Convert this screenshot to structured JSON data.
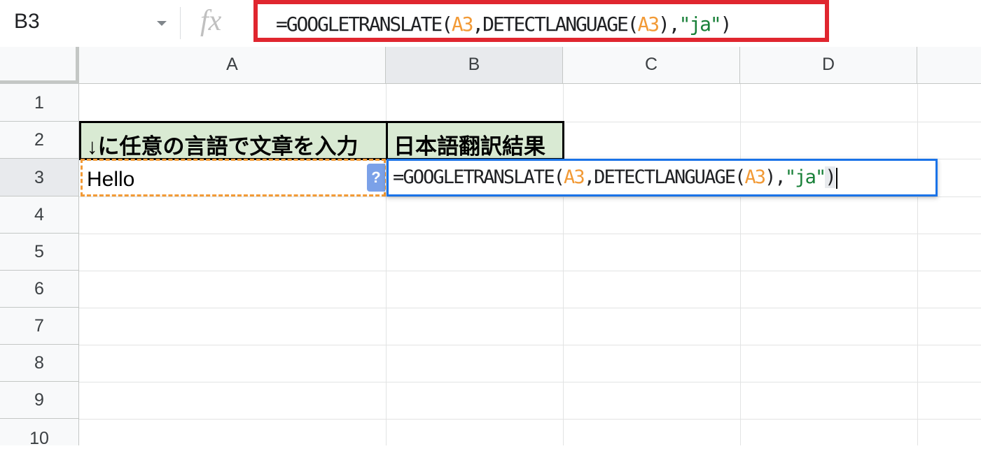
{
  "name_box": {
    "value": "B3"
  },
  "formula_bar": {
    "fx_label": "fx",
    "tokens": [
      {
        "t": "=GOOGLETRANSLATE(",
        "k": "plain"
      },
      {
        "t": "A3",
        "k": "ref"
      },
      {
        "t": ",DETECTLANGUAGE(",
        "k": "plain"
      },
      {
        "t": "A3",
        "k": "ref"
      },
      {
        "t": "),",
        "k": "plain"
      },
      {
        "t": "\"ja\"",
        "k": "str"
      },
      {
        "t": ")",
        "k": "plain"
      }
    ]
  },
  "columns": [
    "A",
    "B",
    "C",
    "D"
  ],
  "rows": [
    "1",
    "2",
    "3",
    "4",
    "5",
    "6",
    "7",
    "8",
    "9",
    "10"
  ],
  "cells": {
    "A2": "↓に任意の言語で文章を入力",
    "B2": "日本語翻訳結果",
    "A3": "Hello"
  },
  "help_chip": "?",
  "colors": {
    "highlight_box": "#e0262f",
    "header_fill": "#d9ead3",
    "reference": "#f29a36",
    "string": "#188038",
    "active_cell": "#1a73e8"
  }
}
